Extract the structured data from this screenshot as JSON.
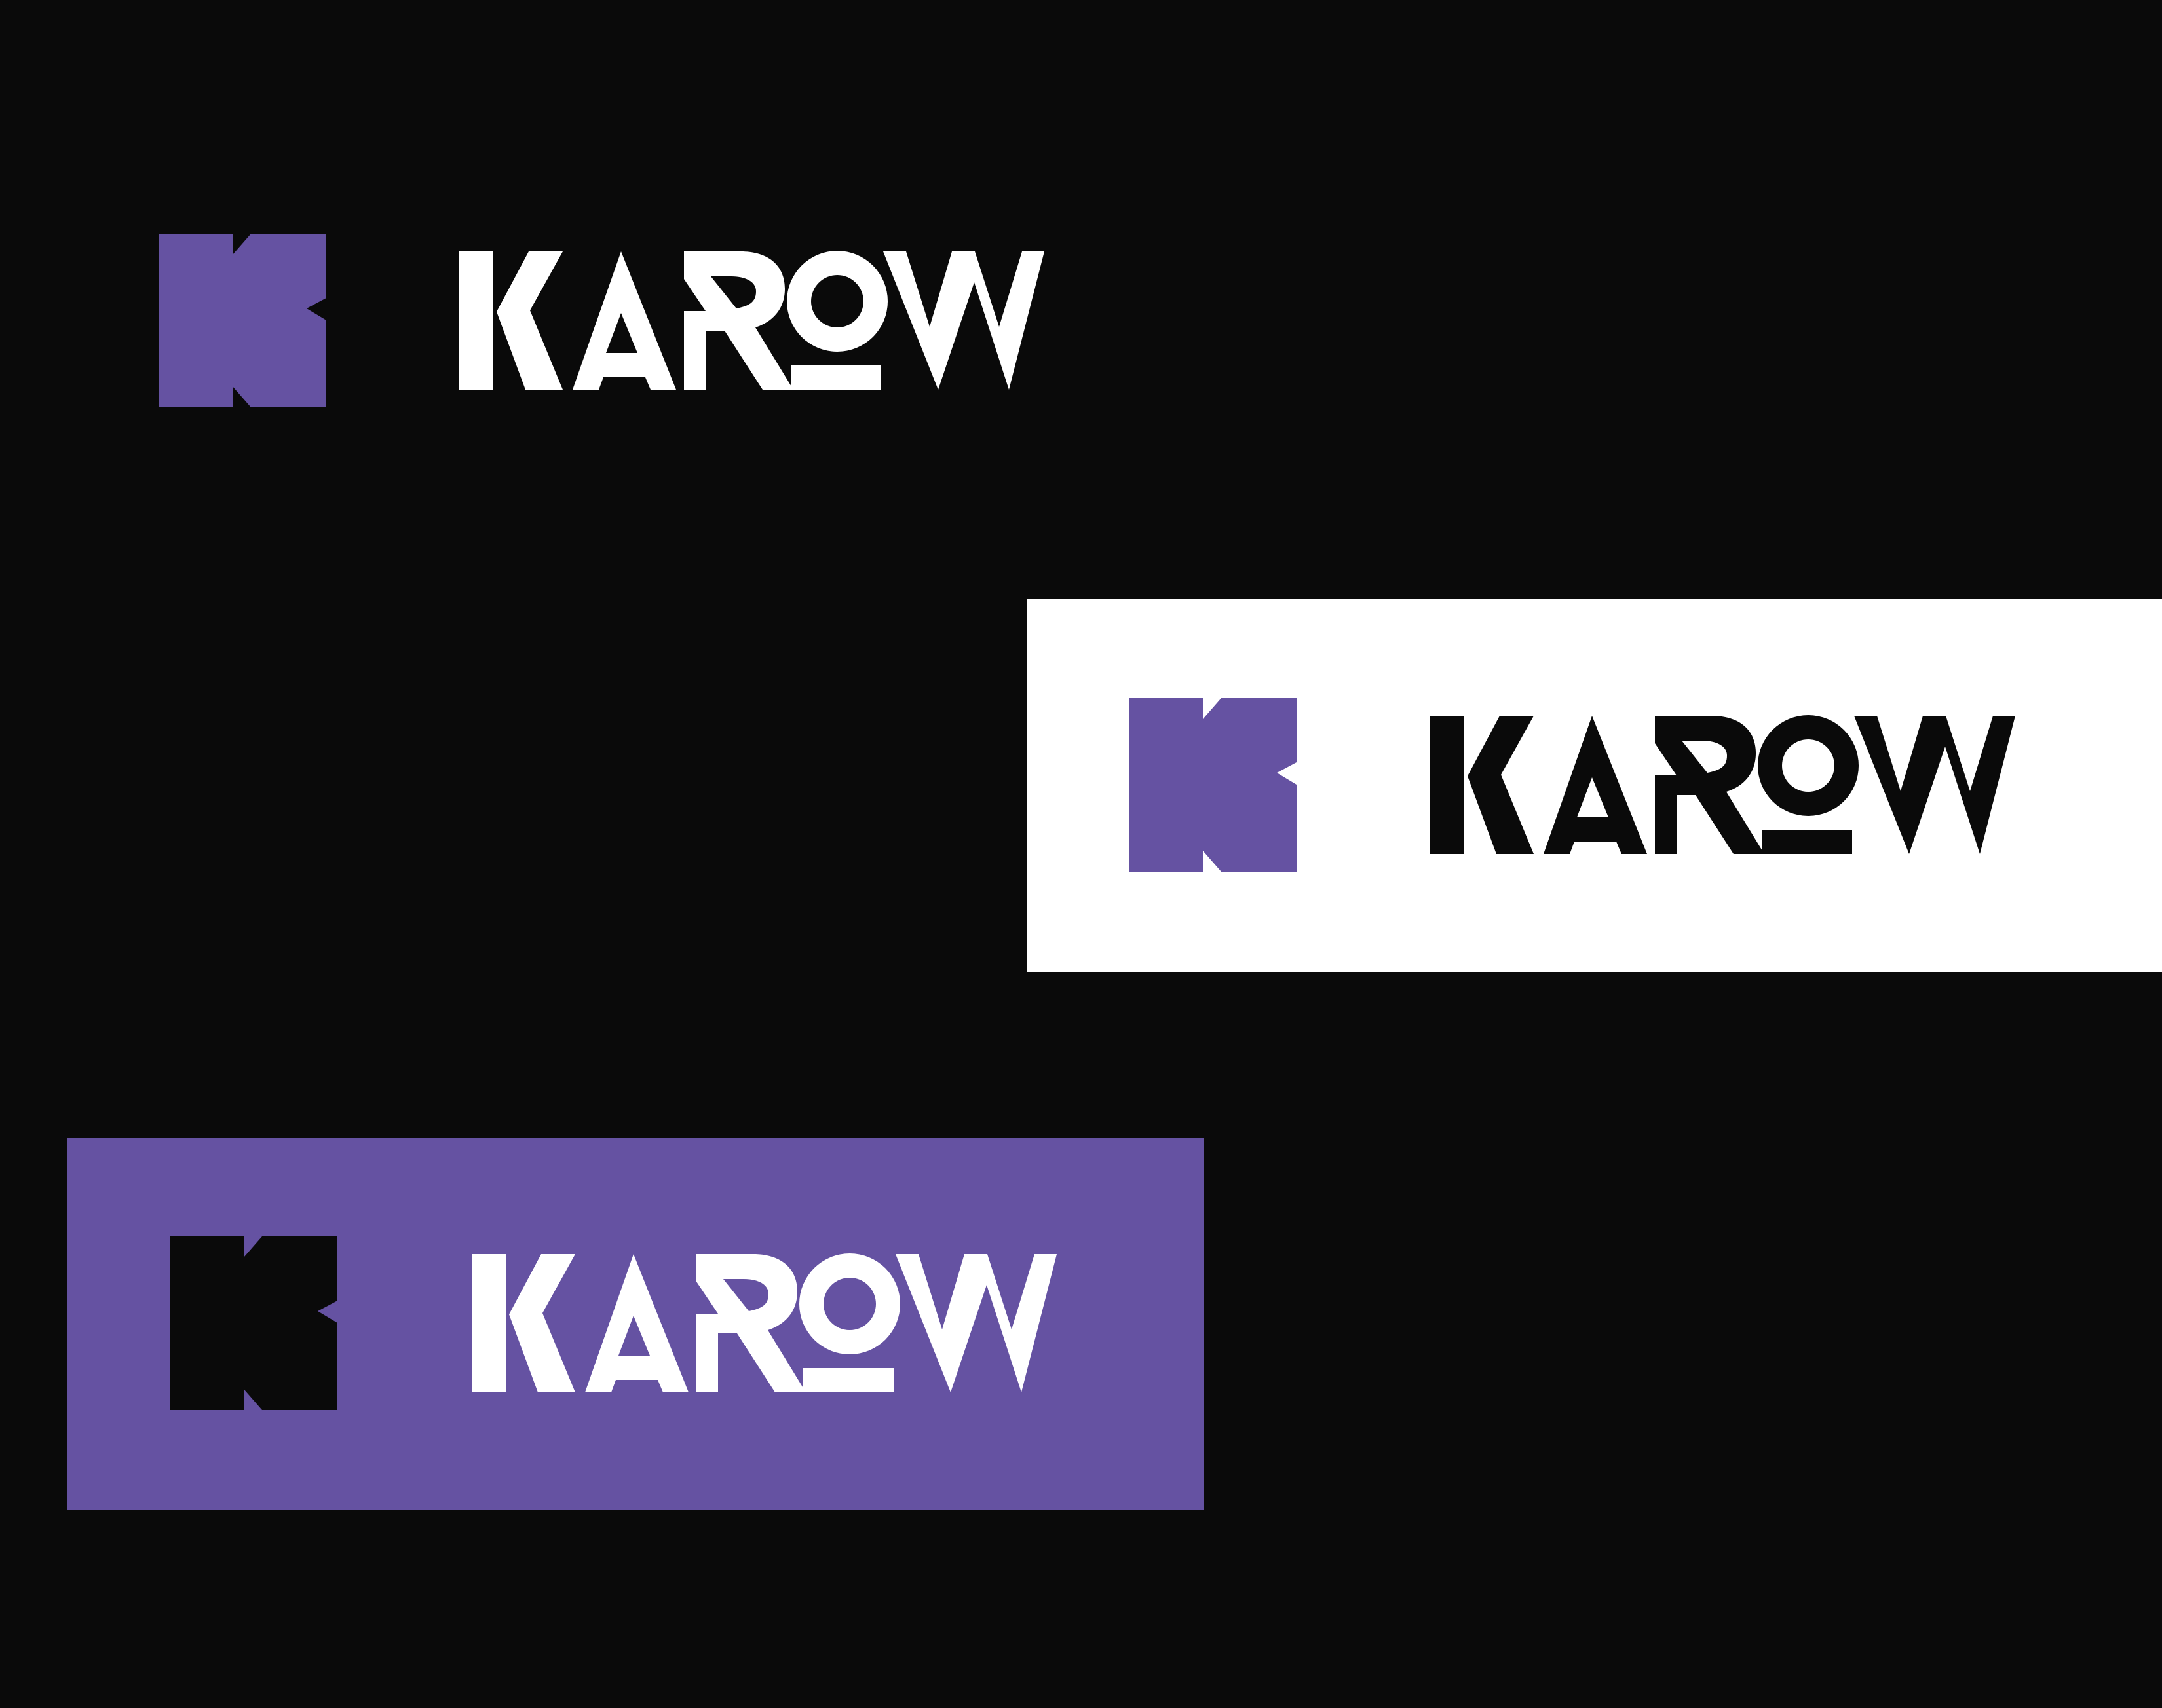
{
  "brand": {
    "name": "KAROW",
    "colors": {
      "background": "#0a0a0a",
      "purple": "#6552a2",
      "white": "#ffffff",
      "black": "#0a0a0a"
    }
  },
  "variants": [
    {
      "id": "on-black",
      "panel": "#0a0a0a",
      "mark": "#6552a2",
      "wordmark": "#ffffff"
    },
    {
      "id": "on-white",
      "panel": "#ffffff",
      "mark": "#6552a2",
      "wordmark": "#0a0a0a"
    },
    {
      "id": "on-purple",
      "panel": "#6552a2",
      "mark": "#0a0a0a",
      "wordmark": "#ffffff"
    }
  ]
}
